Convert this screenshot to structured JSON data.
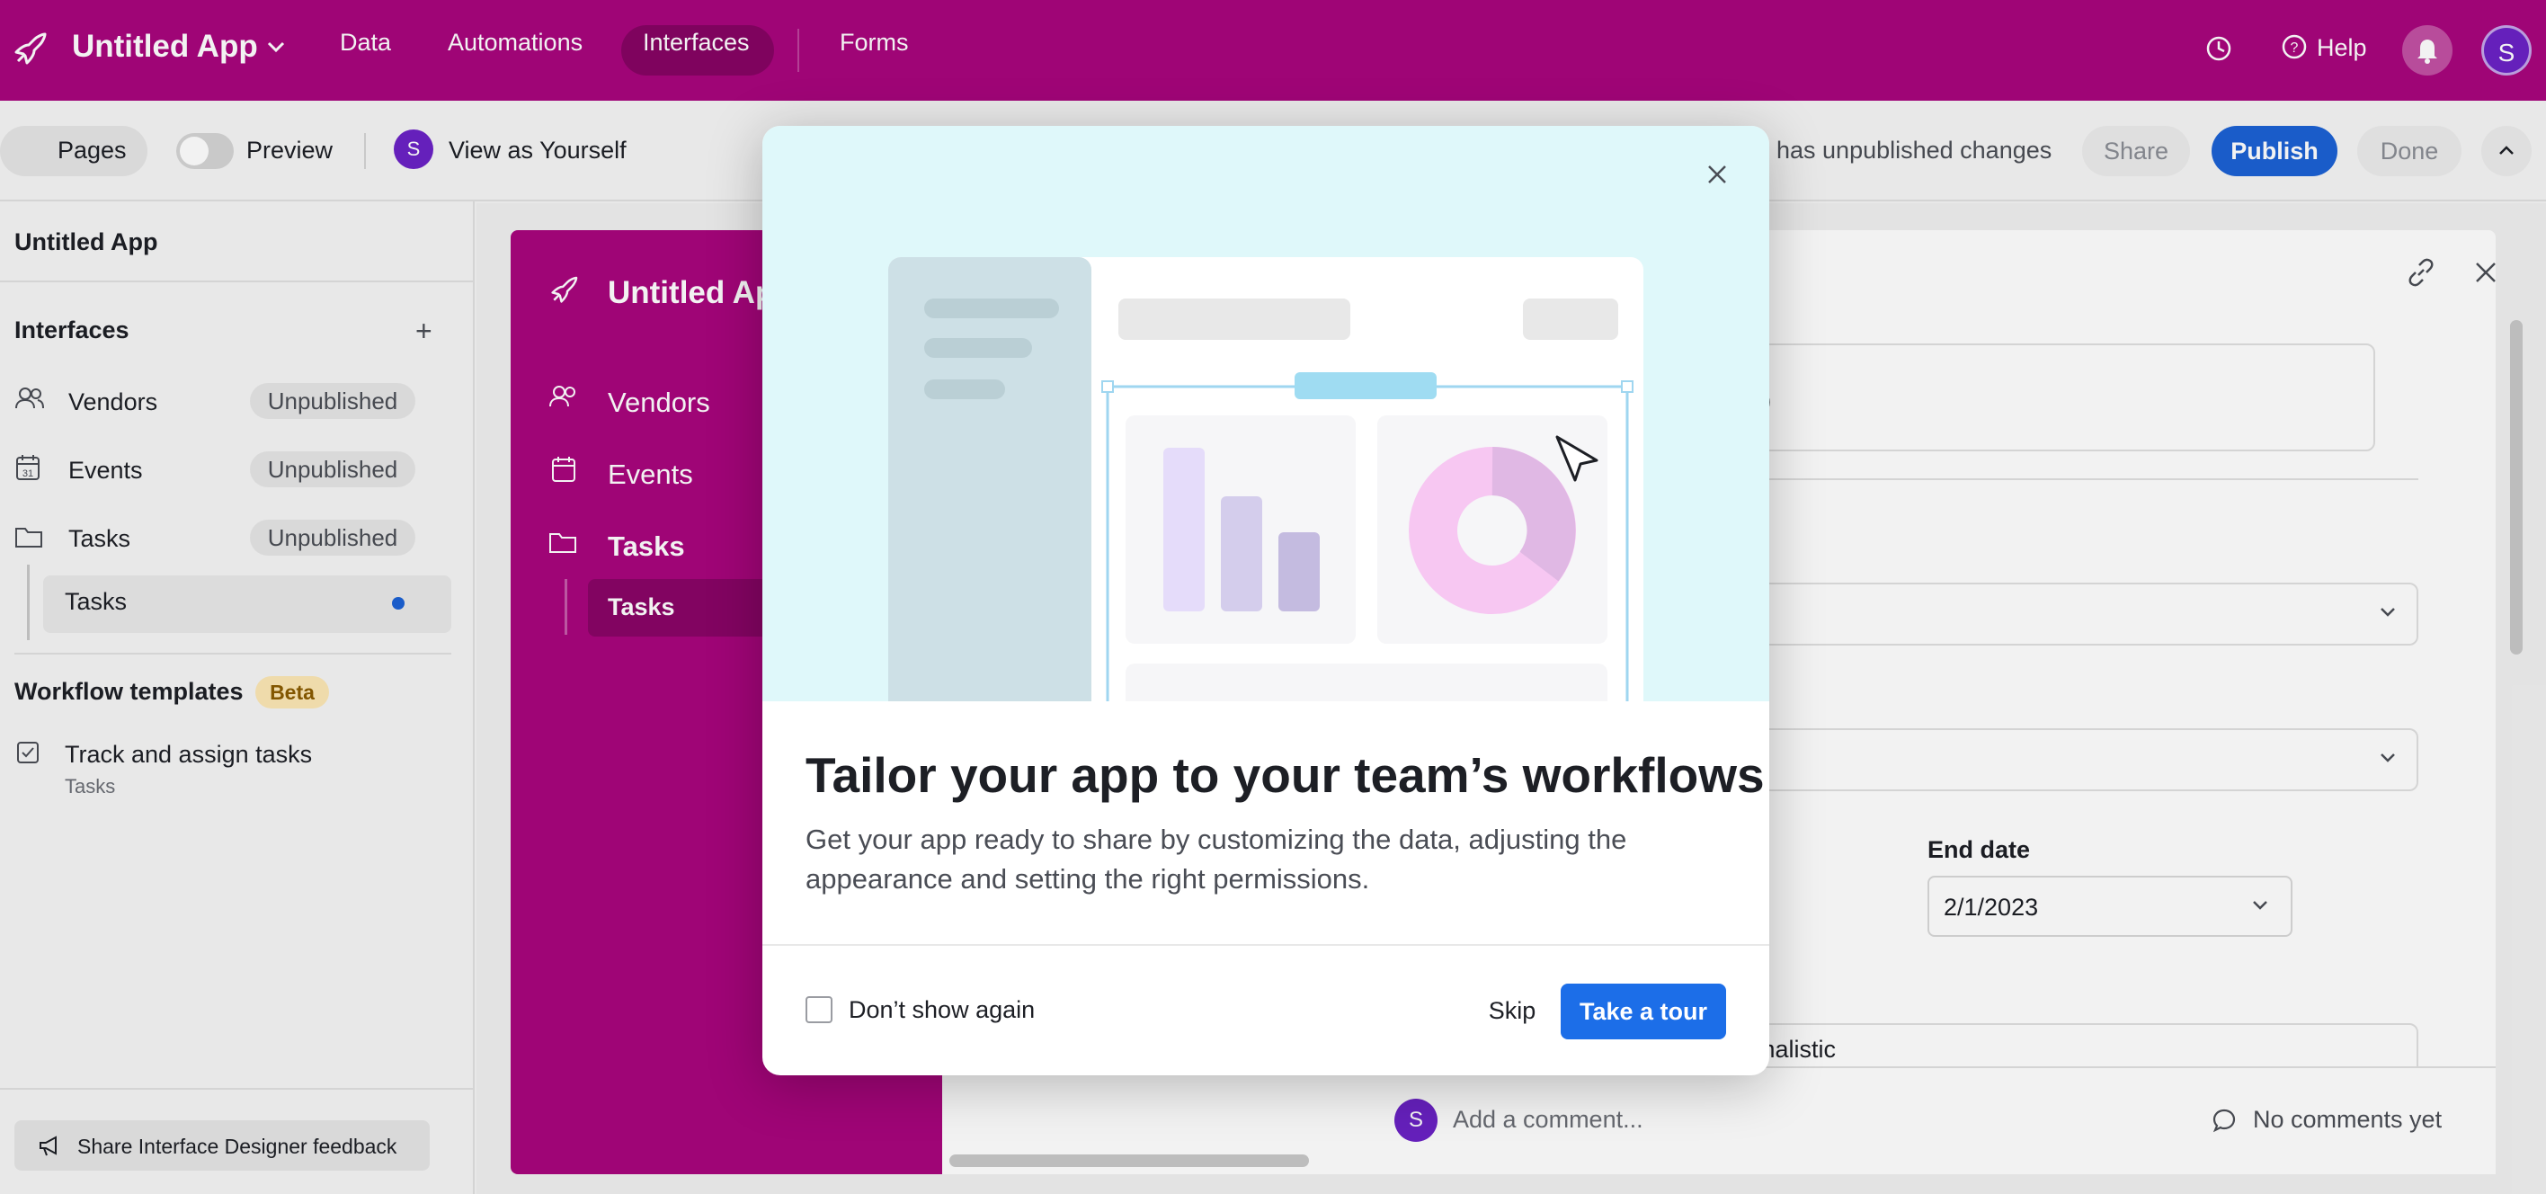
{
  "topbar": {
    "app_title": "Untitled App",
    "nav": [
      "Data",
      "Automations",
      "Interfaces",
      "Forms"
    ],
    "active_nav": "Interfaces",
    "help": "Help",
    "user_initial": "S",
    "brand_color": "#a8067d"
  },
  "toolbar": {
    "pages": "Pages",
    "preview": "Preview",
    "view_as_initial": "S",
    "view_as": "View as Yourself",
    "unpublished_changes": "has unpublished changes",
    "share": "Share",
    "publish": "Publish",
    "done": "Done"
  },
  "sidebar": {
    "title": "Untitled App",
    "interfaces_heading": "Interfaces",
    "items": [
      {
        "label": "Vendors",
        "icon": "users-icon",
        "badge": "Unpublished"
      },
      {
        "label": "Events",
        "icon": "calendar-icon",
        "badge": "Unpublished"
      },
      {
        "label": "Tasks",
        "icon": "folder-icon",
        "badge": "Unpublished"
      }
    ],
    "sub_item": "Tasks",
    "templates_heading": "Workflow templates",
    "beta": "Beta",
    "template_title": "Track and assign tasks",
    "template_sub": "Tasks",
    "feedback": "Share Interface Designer feedback"
  },
  "preview_app": {
    "title": "Untitled Ap",
    "items": [
      "Vendors",
      "Events",
      "Tasks"
    ],
    "sub_item": "Tasks"
  },
  "detail": {
    "title_fragment": "go",
    "end_date_label": "End date",
    "end_date_value": "2/1/2023",
    "text_fragment": "malistic",
    "comment_initial": "S",
    "comment_placeholder": "Add a comment...",
    "no_comments": "No comments yet"
  },
  "modal": {
    "title": "Tailor your app to your team’s workflows",
    "body": "Get your app ready to share by customizing the data, adjusting the appearance and setting the right permissions.",
    "checkbox_label": "Don’t show again",
    "skip": "Skip",
    "take_tour": "Take a tour"
  }
}
